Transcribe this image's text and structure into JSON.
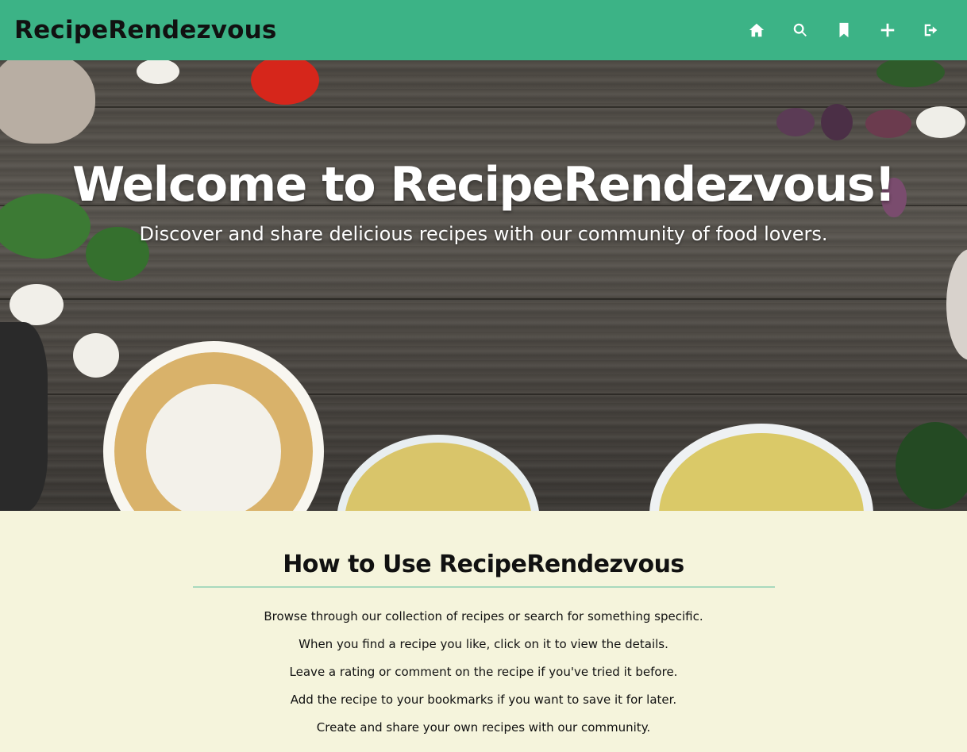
{
  "header": {
    "brand": "RecipeRendezvous",
    "nav": [
      {
        "name": "home-icon"
      },
      {
        "name": "search-icon"
      },
      {
        "name": "bookmark-icon"
      },
      {
        "name": "plus-icon"
      },
      {
        "name": "logout-icon"
      }
    ],
    "colors": {
      "background": "#3cb386",
      "icons": "#ffffff"
    }
  },
  "hero": {
    "title": "Welcome to RecipeRendezvous!",
    "subtitle": "Discover and share delicious recipes with our community of food lovers."
  },
  "howto": {
    "title": "How to Use RecipeRendezvous",
    "steps": [
      "Browse through our collection of recipes or search for something specific.",
      "When you find a recipe you like, click on it to view the details.",
      "Leave a rating or comment on the recipe if you've tried it before.",
      "Add the recipe to your bookmarks if you want to save it for later.",
      "Create and share your own recipes with our community."
    ],
    "colors": {
      "background": "#f5f4dc",
      "rule": "#a8d9bd"
    }
  }
}
